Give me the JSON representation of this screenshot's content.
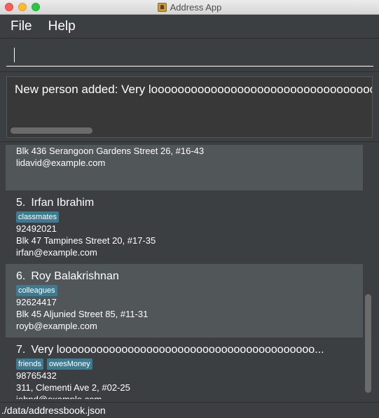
{
  "window": {
    "title": "Address App",
    "app_icon": "address-book-icon"
  },
  "menu": {
    "items": [
      "File",
      "Help"
    ]
  },
  "command_box": {
    "value": "",
    "placeholder": ""
  },
  "result_display": {
    "text": "New person added: Very loooooooooooooooooooooooooooooooooooooooooooooooooooooooooooooooooooooong Name"
  },
  "person_list": {
    "partial_card": {
      "address": "Blk 436 Serangoon Gardens Street 26, #16-43",
      "email": "lidavid@example.com"
    },
    "cards": [
      {
        "index": "5.",
        "name": "Irfan Ibrahim",
        "tags": [
          "classmates"
        ],
        "phone": "92492021",
        "address": "Blk 47 Tampines Street 20, #17-35",
        "email": "irfan@example.com"
      },
      {
        "index": "6.",
        "name": "Roy Balakrishnan",
        "tags": [
          "colleagues"
        ],
        "phone": "92624417",
        "address": "Blk 45 Aljunied Street 85, #11-31",
        "email": "royb@example.com"
      },
      {
        "index": "7.",
        "name": "Very looooooooooooooooooooooooooooooooooooooooo...",
        "tags": [
          "friends",
          "owesMoney"
        ],
        "phone": "98765432",
        "address": "311, Clementi Ave 2, #02-25",
        "email": "johnd@example.com"
      }
    ]
  },
  "status_bar": {
    "save_location": "./data/addressbook.json"
  },
  "colors": {
    "background": "#3c3f41",
    "card_alt": "#515658",
    "tag": "#3e7b91",
    "text": "#ffffff"
  }
}
